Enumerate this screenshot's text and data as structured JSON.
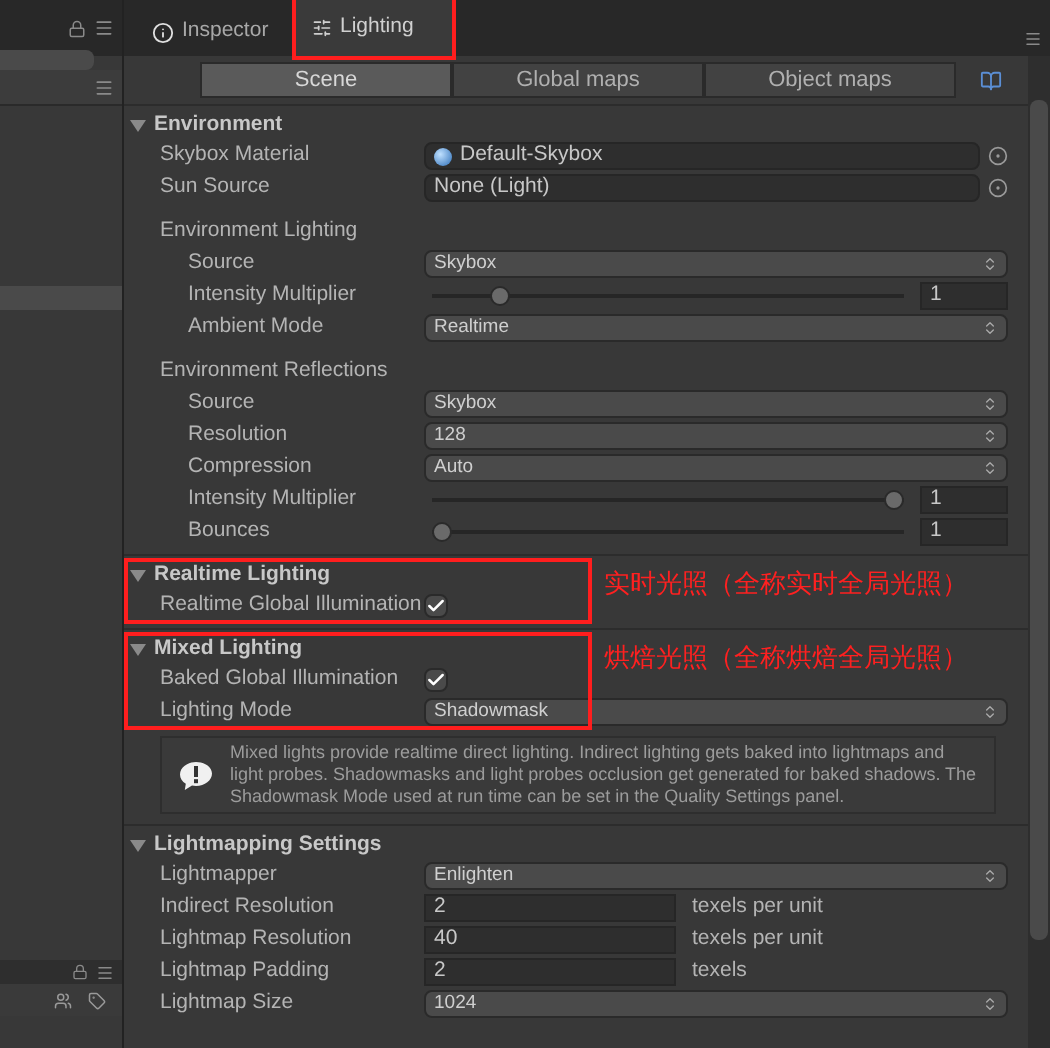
{
  "left_panel": {
    "rows": [
      {
        "selected": true
      }
    ]
  },
  "tabs": [
    {
      "label": "Inspector",
      "selected": false,
      "highlighted": false
    },
    {
      "label": "Lighting",
      "selected": true,
      "highlighted": true
    }
  ],
  "sub_tabs": [
    {
      "label": "Scene",
      "selected": true
    },
    {
      "label": "Global maps",
      "selected": false
    },
    {
      "label": "Object maps",
      "selected": false
    }
  ],
  "sections": [
    {
      "title": "Environment",
      "highlighted": false,
      "rows": [
        {
          "kind": "material",
          "label": "Skybox Material",
          "value": "Default-Skybox"
        },
        {
          "kind": "object",
          "label": "Sun Source",
          "value": "None (Light)"
        },
        {
          "kind": "group",
          "label": "Environment Lighting",
          "children": [
            {
              "kind": "dropdown",
              "label": "Source",
              "value": "Skybox"
            },
            {
              "kind": "slider",
              "label": "Intensity Multiplier",
              "level": 0.13,
              "value": "1"
            },
            {
              "kind": "dropdown",
              "label": "Ambient Mode",
              "value": "Realtime"
            }
          ]
        },
        {
          "kind": "group",
          "label": "Environment Reflections",
          "children": [
            {
              "kind": "dropdown",
              "label": "Source",
              "value": "Skybox"
            },
            {
              "kind": "dropdown",
              "label": "Resolution",
              "value": "128"
            },
            {
              "kind": "dropdown",
              "label": "Compression",
              "value": "Auto"
            },
            {
              "kind": "slider",
              "label": "Intensity Multiplier",
              "level": 1,
              "value": "1"
            },
            {
              "kind": "slider",
              "label": "Bounces",
              "level": 0,
              "value": "1"
            }
          ]
        }
      ]
    },
    {
      "title": "Realtime Lighting",
      "highlighted": true,
      "annotation": "实时光照（全称实时全局光照）",
      "rows": [
        {
          "kind": "checkbox",
          "label": "Realtime Global Illumination",
          "checked": true
        }
      ]
    },
    {
      "title": "Mixed Lighting",
      "highlighted": true,
      "annotation": "烘焙光照（全称烘焙全局光照）",
      "rows": [
        {
          "kind": "checkbox",
          "label": "Baked Global Illumination",
          "checked": true
        },
        {
          "kind": "dropdown",
          "label": "Lighting Mode",
          "value": "Shadowmask"
        }
      ],
      "note": "Mixed lights provide realtime direct lighting. Indirect lighting gets baked into lightmaps and light probes. Shadowmasks and light probes occlusion get generated for baked shadows. The Shadowmask Mode used at run time can be set in the Quality Settings panel."
    },
    {
      "title": "Lightmapping Settings",
      "highlighted": false,
      "rows": [
        {
          "kind": "dropdown",
          "label": "Lightmapper",
          "value": "Enlighten"
        },
        {
          "kind": "number",
          "label": "Indirect Resolution",
          "value": "2",
          "unit": "texels per unit"
        },
        {
          "kind": "number",
          "label": "Lightmap Resolution",
          "value": "40",
          "unit": "texels per unit"
        },
        {
          "kind": "number",
          "label": "Lightmap Padding",
          "value": "2",
          "unit": "texels"
        },
        {
          "kind": "dropdown",
          "label": "Lightmap Size",
          "value": "1024"
        }
      ]
    }
  ]
}
